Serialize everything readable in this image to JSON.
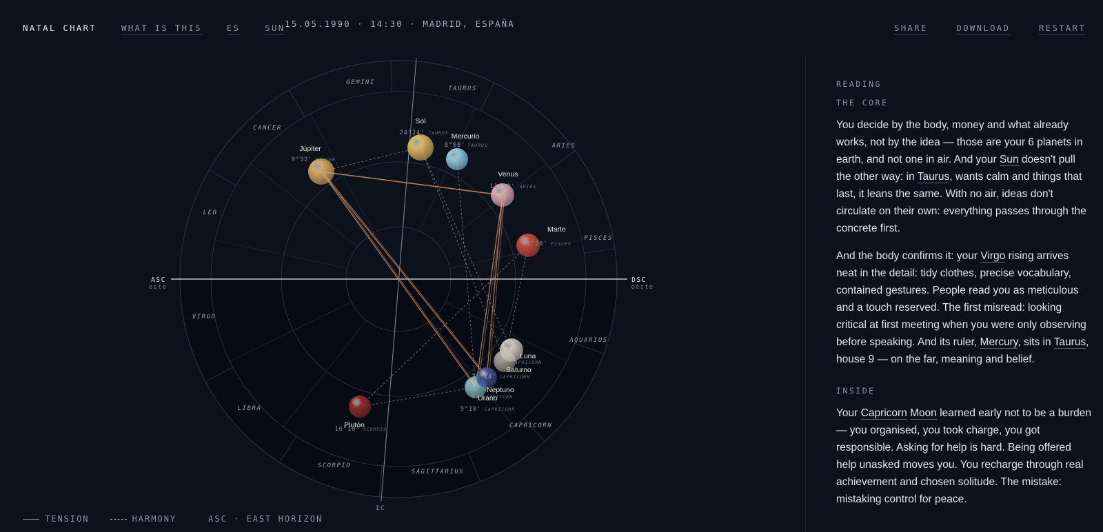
{
  "nav": {
    "brand": "NATAL CHART",
    "what": "WHAT IS THIS",
    "lang": "ES",
    "sun": "SUN"
  },
  "datetime": "15.05.1990 · 14:30 · MADRID, ESPAÑA",
  "actions": {
    "share": "SHARE",
    "download": "DOWNLOAD",
    "restart": "RESTART"
  },
  "colors": {
    "background": "#0d111c",
    "tension": "#c98a62",
    "harmony": "#c8ccd6",
    "text": "#e4e6ec"
  },
  "chart": {
    "asc_label": "ASC",
    "asc_sub": "este",
    "dsc_label": "DSC",
    "dsc_sub": "oeste",
    "ic_label": "IC",
    "signs": [
      "GEMINI",
      "TAURUS",
      "ARIES",
      "PISCES",
      "AQUARIUS",
      "CAPRICORN",
      "SAGITTARIUS",
      "SCORPIO",
      "LIBRA",
      "VIRGO",
      "LEO",
      "CANCER"
    ],
    "planets": [
      {
        "name": "Sol",
        "degree": "24°24'",
        "sign": "TAURUS",
        "color": "#d9b45c",
        "icon": "sun-sphere"
      },
      {
        "name": "Mercurio",
        "degree": "8°08'",
        "sign": "TAURUS",
        "color": "#8fc5d8",
        "icon": "mercury-sphere"
      },
      {
        "name": "Júpiter",
        "degree": "9°32'",
        "sign": "CANCER",
        "color": "#d4a55c",
        "icon": "jupiter-sphere"
      },
      {
        "name": "Venus",
        "degree": "11°50'",
        "sign": "ARIES",
        "color": "#d9a5b0",
        "icon": "venus-sphere"
      },
      {
        "name": "Marte",
        "degree": "18°20'",
        "sign": "PISCES",
        "color": "#c44a38",
        "icon": "mars-sphere"
      },
      {
        "name": "Luna",
        "degree": "",
        "sign": "",
        "color": "#c9c4b8",
        "icon": "moon-sphere"
      },
      {
        "name": "Saturno",
        "degree": "2°",
        "sign": "CAPRICORN",
        "color": "#9a9488",
        "icon": "saturn-sphere"
      },
      {
        "name": "Neptuno",
        "degree": "25°14'",
        "sign": "CAPRICORN",
        "color": "#3f4e86",
        "icon": "neptune-sphere"
      },
      {
        "name": "Urano",
        "degree": "1",
        "sign": "CAPRICORN",
        "color": "#7fb0b5",
        "icon": "uranus-sphere"
      },
      {
        "name": "Plutón",
        "degree": "16°10'",
        "sign": "SCORPIO",
        "color": "#8a2e2a",
        "icon": "pluto-sphere"
      }
    ],
    "urano_degree_line2": "9°10'",
    "urano_sign_line2": "CAPRICORN",
    "aspects": [
      {
        "from": "Júpiter",
        "to": "Venus",
        "type": "tension"
      },
      {
        "from": "Júpiter",
        "to": "Urano",
        "type": "tension"
      },
      {
        "from": "Júpiter",
        "to": "Neptuno",
        "type": "tension"
      },
      {
        "from": "Venus",
        "to": "Urano",
        "type": "tension"
      },
      {
        "from": "Venus",
        "to": "Neptuno",
        "type": "tension"
      },
      {
        "from": "Júpiter",
        "to": "Sol",
        "type": "harmony"
      },
      {
        "from": "Sol",
        "to": "Luna",
        "type": "harmony"
      },
      {
        "from": "Sol",
        "to": "Saturno",
        "type": "harmony"
      },
      {
        "from": "Mercurio",
        "to": "Urano",
        "type": "harmony"
      },
      {
        "from": "Marte",
        "to": "Plutón",
        "type": "harmony"
      },
      {
        "from": "Marte",
        "to": "Saturno",
        "type": "harmony"
      },
      {
        "from": "Plutón",
        "to": "Urano",
        "type": "harmony"
      }
    ]
  },
  "legend": {
    "tension": "TENSION",
    "harmony": "HARMONY",
    "asc": "ASC · EAST HORIZON"
  },
  "reading": {
    "label": "READING",
    "core_label": "THE CORE",
    "p1": {
      "a": "You decide by the body, money and what already works, not by the idea — those are your 6 planets in earth, and not one in air. And your ",
      "sun": "Sun",
      "b": " doesn't pull the other way: in ",
      "taurus": "Taurus",
      "c": ", wants calm and things that last, it leans the same. With no air, ideas don't circulate on their own: everything passes through the concrete first."
    },
    "p2": {
      "a": "And the body confirms it: your ",
      "virgo": "Virgo",
      "b": " rising arrives neat in the detail: tidy clothes, precise vocabulary, contained gestures. People read you as meticulous and a touch reserved. The first misread: looking critical at first meeting when you were only observing before speaking. And its ruler, ",
      "mercury": "Mercury",
      "c": ", sits in ",
      "taurus": "Taurus",
      "d": ", house 9 — on the far, meaning and belief."
    },
    "inside_label": "INSIDE",
    "p3": {
      "a": "Your ",
      "capricorn": "Capricorn",
      "b": " ",
      "moon": "Moon",
      "c": " learned early not to be a burden — you organised, you took charge, you got responsible. Asking for help is hard. Being offered help unasked moves you. You recharge through real achievement and chosen solitude. The mistake: mistaking control for peace."
    }
  }
}
